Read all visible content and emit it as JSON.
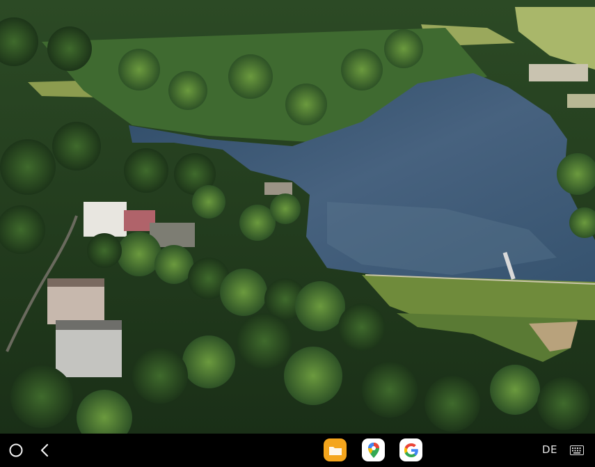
{
  "wallpaper": {
    "subject": "aerial-lake-forest-photo"
  },
  "taskbar": {
    "home_icon": "home-circle-icon",
    "back_icon": "back-chevron-icon",
    "apps": [
      {
        "icon": "file-manager-icon",
        "color": "#f4a51c"
      },
      {
        "icon": "google-maps-icon",
        "color": "#ffffff"
      },
      {
        "icon": "google-icon",
        "color": "#ffffff"
      }
    ],
    "language": "DE",
    "keyboard_icon": "keyboard-icon"
  },
  "colors": {
    "taskbar_bg": "#000000",
    "forest_dark": "#1f3a1f",
    "lake": "#3c5874"
  }
}
